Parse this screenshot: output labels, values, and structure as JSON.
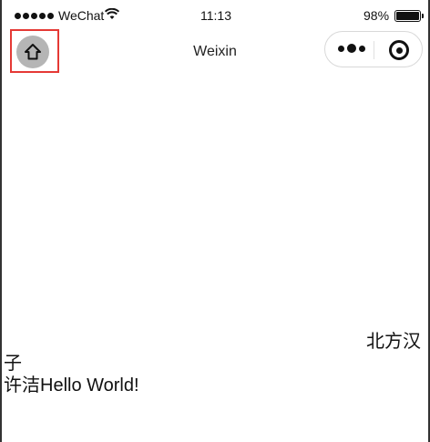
{
  "status_bar": {
    "carrier": "WeChat",
    "time": "11:13",
    "battery": "98%",
    "battery_level": 0.98,
    "icons": [
      "signal-dots",
      "wifi-icon",
      "battery-icon"
    ]
  },
  "nav_bar": {
    "title": "Weixin",
    "home_icon": "home-icon",
    "more_icon": "more-dots-icon",
    "close_icon": "close-target-icon"
  },
  "content": {
    "line1": "北方汉",
    "line2": "子",
    "line3": "许洁Hello World!"
  },
  "colors": {
    "highlight_border": "#e53935",
    "home_button_bg": "#b5b5b5",
    "text": "#111111"
  }
}
